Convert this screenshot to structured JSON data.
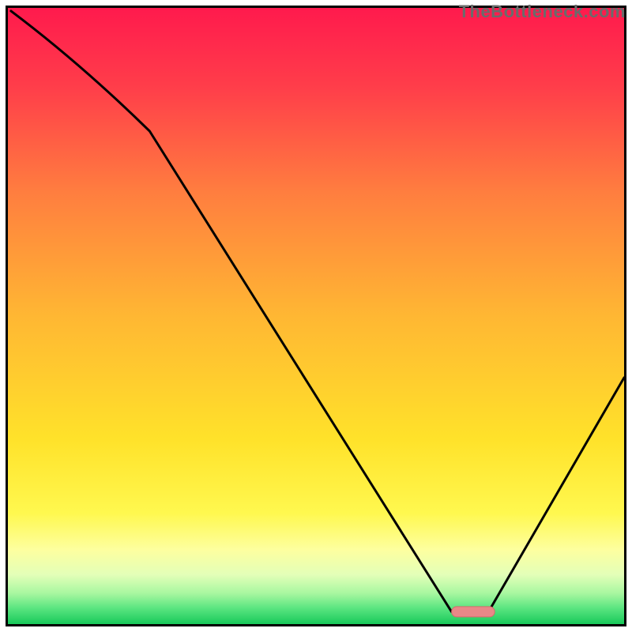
{
  "watermark": "TheBottleneck.com",
  "colors": {
    "frame": "#000000",
    "curve": "#000000",
    "marker_fill": "#e98888",
    "marker_stroke": "#d46c6c",
    "gradient_stops": [
      {
        "offset": 0.0,
        "color": "#ff1a4d"
      },
      {
        "offset": 0.13,
        "color": "#ff3e4a"
      },
      {
        "offset": 0.3,
        "color": "#ff7e3f"
      },
      {
        "offset": 0.5,
        "color": "#ffb733"
      },
      {
        "offset": 0.7,
        "color": "#ffe22a"
      },
      {
        "offset": 0.82,
        "color": "#fff84f"
      },
      {
        "offset": 0.88,
        "color": "#fdffa0"
      },
      {
        "offset": 0.92,
        "color": "#e3ffb8"
      },
      {
        "offset": 0.95,
        "color": "#a8f7a0"
      },
      {
        "offset": 0.975,
        "color": "#58e47f"
      },
      {
        "offset": 1.0,
        "color": "#18c95a"
      }
    ]
  },
  "chart_data": {
    "type": "line",
    "title": "",
    "xlabel": "",
    "ylabel": "",
    "xlim": [
      0,
      100
    ],
    "ylim": [
      0,
      100
    ],
    "grid": false,
    "series": [
      {
        "name": "curve",
        "x": [
          0.5,
          23,
          72,
          78,
          100
        ],
        "y": [
          99.5,
          80,
          2,
          2,
          40
        ]
      }
    ],
    "marker": {
      "x_start": 72,
      "x_end": 79,
      "y": 2
    }
  }
}
